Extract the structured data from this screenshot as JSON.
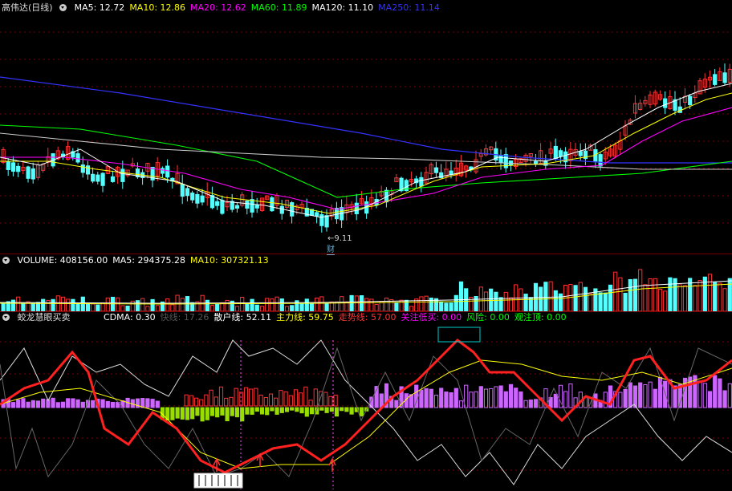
{
  "price_panel": {
    "stock_title": "高伟达(日线)",
    "ma": [
      {
        "label": "MA5: 12.72",
        "color": "#ffffff"
      },
      {
        "label": "MA10: 12.86",
        "color": "#ffff00"
      },
      {
        "label": "MA20: 12.62",
        "color": "#ff00ff"
      },
      {
        "label": "MA60: 11.89",
        "color": "#00ff00"
      },
      {
        "label": "MA120: 11.10",
        "color": "#ffffff"
      },
      {
        "label": "MA250: 11.14",
        "color": "#3333ff"
      }
    ],
    "low_marker": "9.11",
    "event_badge": "财"
  },
  "volume_panel": {
    "items": [
      {
        "label": "VOLUME: 408156.00",
        "color": "#ffffff"
      },
      {
        "label": "MA5: 294375.28",
        "color": "#ffffff"
      },
      {
        "label": "MA10: 307321.13",
        "color": "#ffff00"
      }
    ]
  },
  "indicator_panel": {
    "title": "蛟龙慧眼买卖",
    "items": [
      {
        "label": "CDMA: 0.30",
        "color": "#ffffff"
      },
      {
        "label": "快线: 17.26",
        "color": "#555555"
      },
      {
        "label": "散户线: 52.11",
        "color": "#ffffff"
      },
      {
        "label": "主力线: 59.75",
        "color": "#ffff00"
      },
      {
        "label": "走势线: 57.00",
        "color": "#ff3333"
      },
      {
        "label": "关注低买: 0.00",
        "color": "#ff00ff"
      },
      {
        "label": "风险: 0.00",
        "color": "#00ff00"
      },
      {
        "label": "观注顶: 0.00",
        "color": "#00ff00"
      }
    ]
  },
  "colors": {
    "up": "#ff3232",
    "down": "#54ffff",
    "grid": "#7a0000",
    "background": "#000000"
  }
}
